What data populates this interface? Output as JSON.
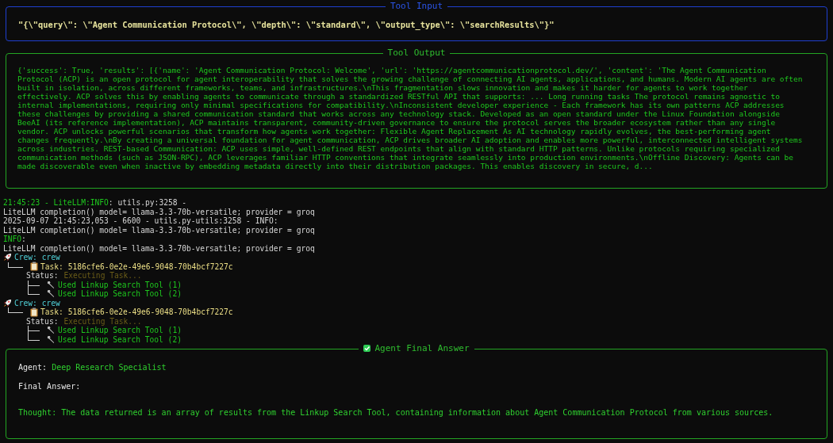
{
  "tool_input": {
    "title": "Tool Input",
    "kind": "input",
    "text": "\"{\\\"query\\\": \\\"Agent Communication Protocol\\\", \\\"depth\\\": \\\"standard\\\", \\\"output_type\\\": \\\"searchResults\\\"}\""
  },
  "tool_output": {
    "title": "Tool Output",
    "kind": "output",
    "lines": [
      "{'success': True, 'results': [{'name': 'Agent Communication Protocol: Welcome', 'url': 'https://agentcommunicationprotocol.dev/', 'content': 'The Agent Communication",
      "Protocol (ACP) is an open protocol for agent interoperability that solves the growing challenge of connecting AI agents, applications, and humans. Modern AI agents are often",
      "built in isolation, across different frameworks, teams, and infrastructures.\\nThis fragmentation slows innovation and makes it harder for agents to work together",
      "effectively. ACP solves this by enabling agents to communicate through a standardized RESTful API that supports: ... Long running tasks The protocol remains agnostic to",
      "internal implementations, requiring only minimal specifications for compatibility.\\nInconsistent developer experience - Each framework has its own patterns ACP addresses",
      "these challenges by providing a shared communication standard that works across any technology stack. Developed as an open standard under the Linux Foundation alongside",
      "BeeAI (its reference implementation), ACP maintains transparent, community-driven governance to ensure the protocol serves the broader ecosystem rather than any single",
      "vendor. ACP unlocks powerful scenarios that transform how agents work together: Flexible Agent Replacement As AI technology rapidly evolves, the best-performing agent",
      "changes frequently.\\nBy creating a universal foundation for agent communication, ACP drives broader AI adoption and enables more powerful, interconnected intelligent systems",
      "across industries. REST-based Communication: ACP uses simple, well-defined REST endpoints that align with standard HTTP patterns. Unlike protocols requiring specialized",
      "communication methods (such as JSON-RPC), ACP leverages familiar HTTP conventions that integrate seamlessly into production environments.\\nOffline Discovery: Agents can be",
      "made discoverable even when inactive by embedding metadata directly into their distribution packages. This enables discovery in secure, d..."
    ]
  },
  "log_lines": [
    {
      "segments": [
        {
          "text": "21:45:23 - LiteLLM:INFO",
          "kind": "highlight"
        },
        {
          "text": ": utils.py:3258 -",
          "kind": "plain"
        }
      ]
    },
    {
      "segments": [
        {
          "text": "LiteLLM completion() model= llama-3.3-70b-versatile; provider = groq",
          "kind": "plain"
        }
      ]
    },
    {
      "segments": [
        {
          "text": "2025-09-07 21:45:23,053 - 6600 - utils.py-utils:3258 - INFO:",
          "kind": "plain"
        }
      ]
    },
    {
      "segments": [
        {
          "text": "LiteLLM completion() model= llama-3.3-70b-versatile; provider = groq",
          "kind": "plain"
        }
      ]
    },
    {
      "segments": [
        {
          "text": "INFO",
          "kind": "highlight"
        },
        {
          "text": ":",
          "kind": "plain"
        }
      ]
    },
    {
      "segments": [
        {
          "text": "LiteLLM completion() model= llama-3.3-70b-versatile; provider = groq",
          "kind": "plain"
        }
      ]
    }
  ],
  "crews": [
    {
      "label": "Crew: crew",
      "task_label": "Task:",
      "task_id": "5186cfe6-0e2e-49e6-9048-70b4bcf7227c",
      "status_label": "Status:",
      "status": "Executing Task...",
      "tools": [
        "Used Linkup Search Tool (1)",
        "Used Linkup Search Tool (2)"
      ]
    },
    {
      "label": "Crew: crew",
      "task_label": "Task:",
      "task_id": "5186cfe6-0e2e-49e6-9048-70b4bcf7227c",
      "status_label": "Status:",
      "status": "Executing Task...",
      "tools": [
        "Used Linkup Search Tool (1)",
        "Used Linkup Search Tool (2)"
      ]
    }
  ],
  "final_answer": {
    "title": "Agent Final Answer",
    "kind": "final",
    "checked": true,
    "agent_label": "Agent:",
    "agent": "Deep Research Specialist",
    "answer_label": "Final Answer:",
    "thought": "Thought: The data returned is an array of results from the Linkup Search Tool, containing information about Agent Communication Protocol from various sources."
  }
}
